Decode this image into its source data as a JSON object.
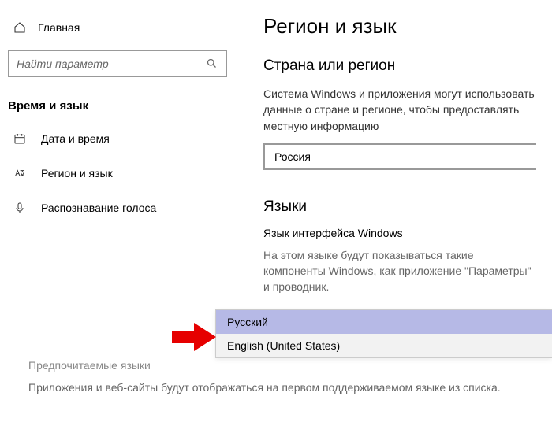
{
  "sidebar": {
    "home_label": "Главная",
    "search_placeholder": "Найти параметр",
    "section_title": "Время и язык",
    "items": [
      {
        "label": "Дата и время"
      },
      {
        "label": "Регион и язык"
      },
      {
        "label": "Распознавание голоса"
      }
    ]
  },
  "main": {
    "page_title": "Регион и язык",
    "region_group_title": "Страна или регион",
    "region_desc": "Система Windows и приложения могут использовать данные о стране и регионе, чтобы предоставлять местную информацию",
    "region_value": "Россия",
    "languages_group_title": "Языки",
    "interface_lang_title": "Язык интерфейса Windows",
    "interface_lang_desc": "На этом языке будут показываться такие компоненты Windows, как приложение \"Параметры\" и проводник.",
    "dropdown_options": [
      {
        "label": "Русский",
        "selected": true
      },
      {
        "label": "English (United States)",
        "selected": false
      }
    ],
    "preferred_title": "Предпочитаемые языки",
    "preferred_desc": "Приложения и веб-сайты будут отображаться на первом поддерживаемом языке из списка."
  }
}
